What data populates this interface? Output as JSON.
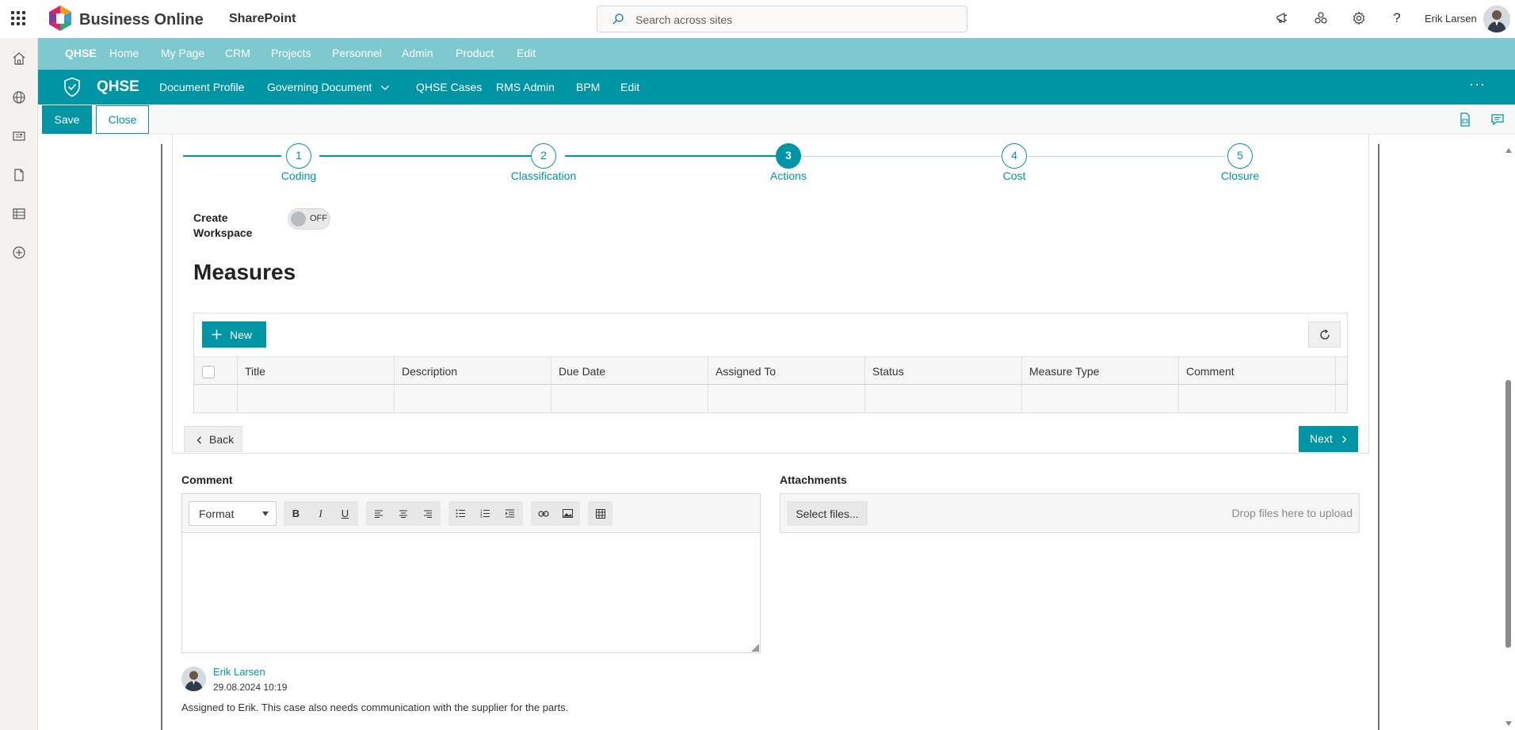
{
  "suite": {
    "brand": "Business Online",
    "app": "SharePoint",
    "search_placeholder": "Search across sites",
    "user": "Erik Larsen"
  },
  "hubnav": [
    "QHSE",
    "Home",
    "My Page",
    "CRM",
    "Projects",
    "Personnel",
    "Admin",
    "Product",
    "Edit"
  ],
  "site": {
    "title": "QHSE",
    "nav": [
      "Document Profile",
      "Governing Document",
      "QHSE Cases",
      "RMS Admin",
      "BPM",
      "Edit"
    ]
  },
  "commands": {
    "save": "Save",
    "close": "Close"
  },
  "steps": [
    {
      "num": "1",
      "label": "Coding"
    },
    {
      "num": "2",
      "label": "Classification"
    },
    {
      "num": "3",
      "label": "Actions"
    },
    {
      "num": "4",
      "label": "Cost"
    },
    {
      "num": "5",
      "label": "Closure"
    }
  ],
  "active_step": 3,
  "workspace": {
    "label_line1": "Create",
    "label_line2": "Workspace",
    "toggle": "OFF"
  },
  "measures": {
    "title": "Measures",
    "new_label": "New",
    "columns": [
      "Title",
      "Description",
      "Due Date",
      "Assigned To",
      "Status",
      "Measure Type",
      "Comment"
    ],
    "rows": []
  },
  "wizard_nav": {
    "back": "Back",
    "next": "Next"
  },
  "comment": {
    "label": "Comment",
    "format": "Format"
  },
  "attachments": {
    "label": "Attachments",
    "select": "Select files...",
    "drop": "Drop files here to upload"
  },
  "comment_entry": {
    "author": "Erik Larsen",
    "date": "29.08.2024 10:19",
    "text": "Assigned to Erik. This case also needs communication with the supplier for the parts."
  },
  "colors": {
    "accent": "#0095a5",
    "hub": "#7ec8d0"
  }
}
